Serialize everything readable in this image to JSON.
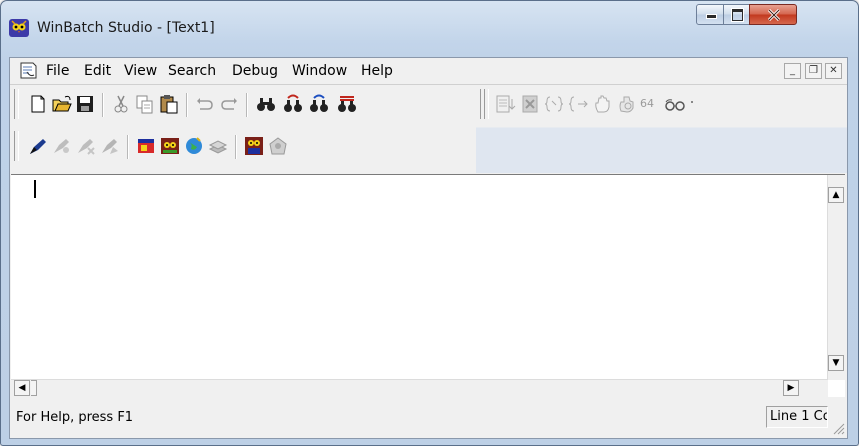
{
  "window": {
    "title": "WinBatch Studio - [Text1]",
    "caption_buttons": {
      "minimize": "minimize",
      "maximize": "maximize",
      "close": "close"
    }
  },
  "menu": {
    "items": [
      {
        "label": "File",
        "icon": "document-icon"
      },
      {
        "label": "Edit"
      },
      {
        "label": "View"
      },
      {
        "label": "Search"
      },
      {
        "label": "Debug"
      },
      {
        "label": "Window"
      },
      {
        "label": "Help"
      }
    ],
    "mdi_buttons": [
      "minimize-child",
      "restore-child",
      "close-child"
    ]
  },
  "toolbar": {
    "standard": [
      "new-file-icon",
      "open-folder-icon",
      "save-disk-icon",
      "cut-icon",
      "copy-icon",
      "paste-icon",
      "undo-icon",
      "redo-icon",
      "find-icon",
      "find-next-icon",
      "find-previous-icon",
      "replace-icon"
    ],
    "debug": [
      "step-into-icon",
      "step-over-icon",
      "step-out-icon",
      "run-to-cursor-icon",
      "hand-stop-icon",
      "break-icon",
      "64bit-label",
      "watch-glasses-icon"
    ],
    "debug_64_label": "64",
    "tools": [
      "pen-icon",
      "compile-icon",
      "compile-alt-icon",
      "compile-all-icon",
      "dialog-editor-icon",
      "owl-icon",
      "globe-icon",
      "stack-icon",
      "owl-64-icon",
      "network-icon"
    ]
  },
  "editor": {
    "text": ""
  },
  "statusbar": {
    "help_text": "For Help, press F1",
    "position_text": "Line 1 Co"
  },
  "colors": {
    "title_gradient": "#c3d5ea",
    "close_red": "#c2391f",
    "client_bg": "#f0f0f0"
  }
}
